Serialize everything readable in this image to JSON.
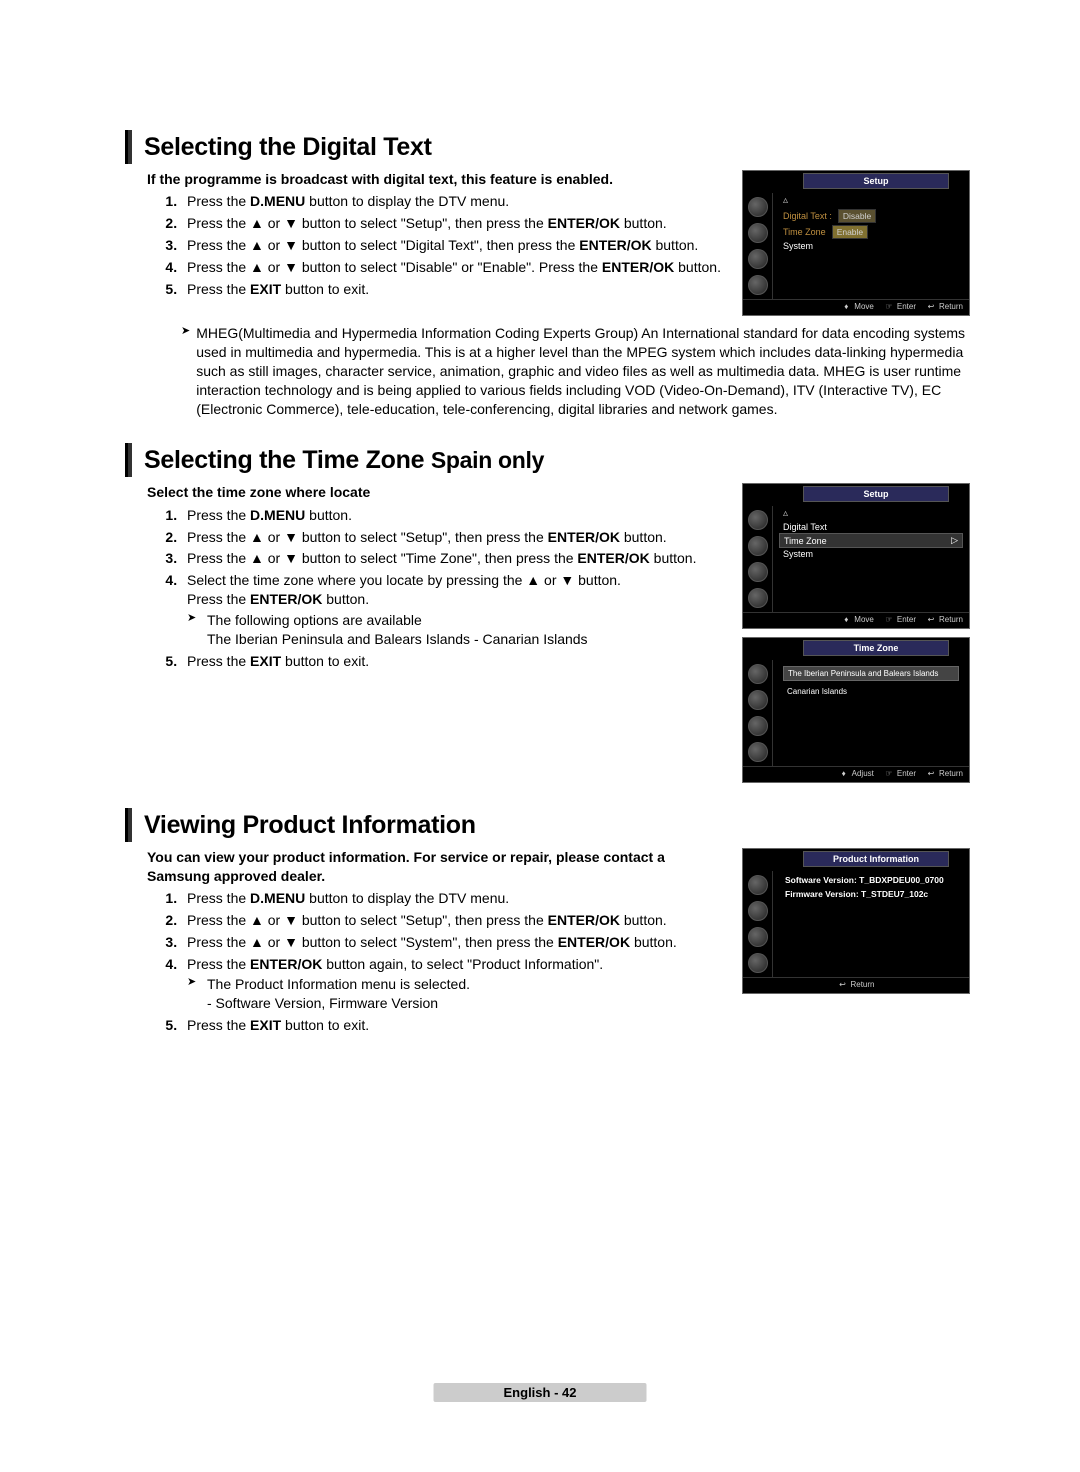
{
  "section1": {
    "title": "Selecting the Digital Text",
    "intro": "If the programme is broadcast with digital text, this feature is enabled.",
    "steps": {
      "s1_a": "Press the ",
      "s1_b": "D.MENU",
      "s1_c": " button to display the DTV menu.",
      "s2_a": "Press the ▲ or ▼ button to select \"Setup\", then press the ",
      "s2_b": "ENTER/OK",
      "s2_c": " button.",
      "s3_a": "Press the ▲ or ▼ button to select \"Digital Text\", then press the ",
      "s3_b": "ENTER/OK",
      "s3_c": " button.",
      "s4_a": "Press the ▲ or ▼ button to select \"Disable\" or \"Enable\". Press the ",
      "s4_b": "ENTER/OK",
      "s4_c": " button.",
      "s5_a": "Press the ",
      "s5_b": "EXIT",
      "s5_c": " button to exit."
    },
    "note": "MHEG(Multimedia and Hypermedia Information Coding Experts Group) An International standard for data encoding systems used in multimedia and hypermedia. This is at a higher level than the MPEG system which includes data-linking hypermedia such as still images, character service, animation, graphic and video files as well as multimedia data. MHEG is user runtime interaction technology and is being applied to various fields including VOD (Video-On-Demand), ITV (Interactive TV), EC (Electronic Commerce), tele-education, tele-conferencing, digital libraries and network games.",
    "panel": {
      "title": "Setup",
      "row1": "Digital Text :",
      "opt1": "Disable",
      "row2": "Time Zone",
      "opt2": "Enable",
      "row3": "System",
      "f1": "Move",
      "f2": "Enter",
      "f3": "Return"
    }
  },
  "section2": {
    "title_a": "Selecting the Time Zone ",
    "title_b": "Spain only",
    "intro": "Select the time zone where locate",
    "steps": {
      "s1_a": "Press the ",
      "s1_b": "D.MENU",
      "s1_c": " button.",
      "s2_a": "Press the ▲ or ▼ button to select \"Setup\", then press the ",
      "s2_b": "ENTER/OK",
      "s2_c": " button.",
      "s3_a": "Press the ▲ or ▼ button to select \"Time Zone\", then press the ",
      "s3_b": "ENTER/OK",
      "s3_c": " button.",
      "s4": "Select the time zone where you locate by pressing the ▲ or ▼ button.",
      "s4b_a": "Press the ",
      "s4b_b": "ENTER/OK",
      "s4b_c": " button.",
      "s4_note1": "The following options are available",
      "s4_note2": "The Iberian Peninsula and Balears Islands - Canarian Islands",
      "s5_a": "Press the ",
      "s5_b": "EXIT",
      "s5_c": " button to exit."
    },
    "panelA": {
      "title": "Setup",
      "row1": "Digital Text",
      "row2": "Time Zone",
      "row3": "System",
      "f1": "Move",
      "f2": "Enter",
      "f3": "Return"
    },
    "panelB": {
      "title": "Time Zone",
      "item1": "The Iberian Peninsula and Balears Islands",
      "item2": "Canarian Islands",
      "f1": "Adjust",
      "f2": "Enter",
      "f3": "Return"
    }
  },
  "section3": {
    "title": "Viewing Product Information",
    "intro": "You can view your product information. For service or repair, please contact a Samsung approved dealer.",
    "steps": {
      "s1_a": "Press the ",
      "s1_b": "D.MENU",
      "s1_c": " button to display the DTV menu.",
      "s2_a": "Press the ▲ or ▼ button to select \"Setup\", then press the ",
      "s2_b": "ENTER/OK",
      "s2_c": " button.",
      "s3_a": "Press the ▲ or ▼ button to select \"System\", then press the ",
      "s3_b": "ENTER/OK",
      "s3_c": " button.",
      "s4_a": "Press the ",
      "s4_b": "ENTER/OK",
      "s4_c": " button again, to select \"Product Information\".",
      "s4_note1": "The Product Information menu is selected.",
      "s4_note2": "- Software Version, Firmware Version",
      "s5_a": "Press the ",
      "s5_b": "EXIT",
      "s5_c": " button to exit."
    },
    "panel": {
      "title": "Product Information",
      "line1": "Software Version: T_BDXPDEU00_0700",
      "line2": "Firmware Version: T_STDEU7_102c",
      "f1": "Return"
    }
  },
  "footer": "English - 42"
}
